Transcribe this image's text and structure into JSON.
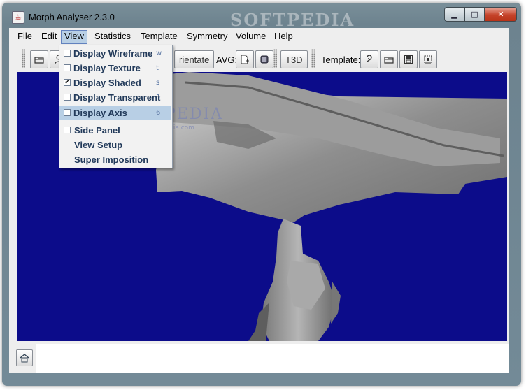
{
  "window": {
    "title": "Morph Analyser 2.3.0",
    "watermark_title": "SOFTPEDIA",
    "caption_buttons": {
      "minimize": "▁",
      "maximize": "□",
      "close": "✕"
    }
  },
  "menubar": {
    "items": [
      {
        "label": "File"
      },
      {
        "label": "Edit"
      },
      {
        "label": "View"
      },
      {
        "label": "Statistics"
      },
      {
        "label": "Template"
      },
      {
        "label": "Symmetry"
      },
      {
        "label": "Volume"
      },
      {
        "label": "Help"
      }
    ]
  },
  "toolbar": {
    "orientate_label": "rientate",
    "avg_label": "AVG:",
    "t3d_label": "T3D",
    "template_label": "Template:"
  },
  "view_menu": {
    "items": [
      {
        "label": "Display Wireframe",
        "shortcut": "w",
        "checked": false
      },
      {
        "label": "Display Texture",
        "shortcut": "t",
        "checked": false
      },
      {
        "label": "Display Shaded",
        "shortcut": "s",
        "checked": true,
        "check_mark": "✔"
      },
      {
        "label": "Display Transparent",
        "shortcut": "5",
        "checked": false
      },
      {
        "label": "Display Axis",
        "shortcut": "6",
        "checked": false,
        "highlighted": true
      },
      {
        "label": "Side Panel",
        "checked": false
      },
      {
        "label": "View Setup"
      },
      {
        "label": "Super Imposition"
      }
    ]
  },
  "viewport": {
    "background": "#0c0c8a",
    "mesh_color": "#8a8a8a",
    "watermark": "SOFTPEDIA",
    "watermark_sub": "www.softpedia.com"
  }
}
